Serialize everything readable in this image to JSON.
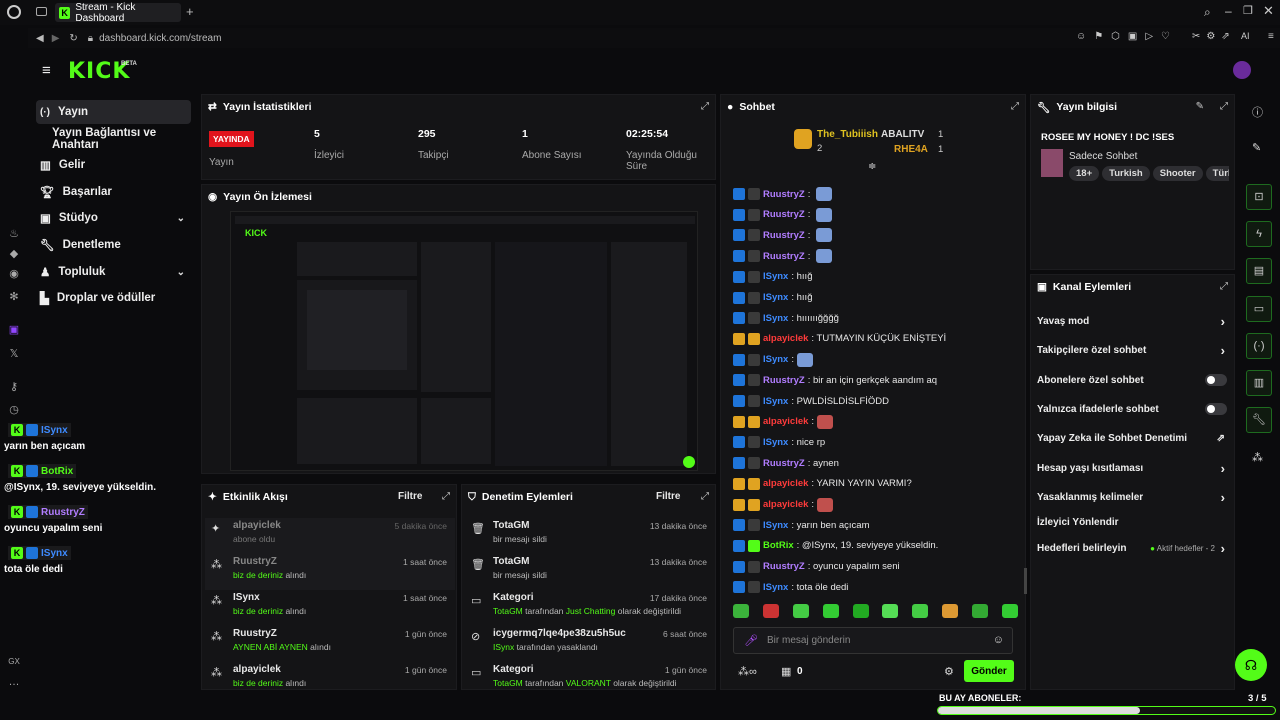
{
  "browser": {
    "tab_title": "Stream - Kick Dashboard",
    "new_tab": "+",
    "url": "dashboard.kick.com/stream",
    "gx_label": "GX",
    "ai_label": "AI"
  },
  "header": {
    "logo": "KICK",
    "beta": "BETA"
  },
  "nav": {
    "items": [
      {
        "label": "Yayın",
        "icon": "broadcast-icon"
      },
      {
        "label": "Yayın Bağlantısı ve Anahtarı",
        "icon": ""
      },
      {
        "label": "Gelir",
        "icon": "revenue-icon"
      },
      {
        "label": "Başarılar",
        "icon": "trophy-icon"
      },
      {
        "label": "Stüdyo",
        "icon": "studio-icon"
      },
      {
        "label": "Denetleme",
        "icon": "wrench-icon"
      },
      {
        "label": "Topluluk",
        "icon": "community-icon"
      },
      {
        "label": "Droplar ve ödüller",
        "icon": "drops-icon"
      }
    ]
  },
  "stats": {
    "title": "Yayın İstatistikleri",
    "live_badge": "YAYINDA",
    "live_label": "Yayın",
    "viewers_value": "5",
    "viewers_label": "İzleyici",
    "followers_value": "295",
    "followers_label": "Takipçi",
    "subs_value": "1",
    "subs_label": "Abone Sayısı",
    "uptime_value": "02:25:54",
    "uptime_label": "Yayında Olduğu Süre"
  },
  "preview": {
    "title": "Yayın Ön İzlemesi"
  },
  "events": {
    "title": "Etkinlik Akışı",
    "filter": "Filtre",
    "rows": [
      {
        "name": "alpayiclek",
        "sub": "abone oldu",
        "time": "5 dakika önce"
      },
      {
        "name": "RuustryZ",
        "sub_green": "biz de deriniz",
        "sub": " alındı",
        "time": "1 saat önce"
      },
      {
        "name": "ISynx",
        "sub_green": "biz de deriniz",
        "sub": " alındı",
        "time": "1 saat önce"
      },
      {
        "name": "RuustryZ",
        "sub_green": "AYNEN ABİ AYNEN",
        "sub": " alındı",
        "time": "1 gün önce"
      },
      {
        "name": "alpayiclek",
        "sub_green": "biz de deriniz",
        "sub": " alındı",
        "time": "1 gün önce"
      }
    ]
  },
  "moderation": {
    "title": "Denetim Eylemleri",
    "filter": "Filtre",
    "rows": [
      {
        "name": "TotaGM",
        "sub": "bir mesajı sildi",
        "time": "13 dakika önce"
      },
      {
        "name": "TotaGM",
        "sub": "bir mesajı sildi",
        "time": "13 dakika önce"
      },
      {
        "name": "Kategori",
        "sub_green": "TotaGM",
        "sub": " tarafından ",
        "sub_green2": "Just Chatting",
        "sub2": " olarak değiştirildi",
        "time": "17 dakika önce"
      },
      {
        "name": "icygermq7lqe4pe38zu5h5uc",
        "sub_green": "ISynx",
        "sub": " tarafından yasaklandı",
        "time": "6 saat önce"
      },
      {
        "name": "Kategori",
        "sub_green": "TotaGM",
        "sub": " tarafından ",
        "sub_green2": "VALORANT",
        "sub2": " olarak değiştirildi",
        "time": "1 gün önce"
      }
    ]
  },
  "chat": {
    "title": "Sohbet",
    "top1": "The_Tubiiish",
    "top1_count": "2",
    "top2": "ABALITV",
    "top2_count": "1",
    "top3": "RHE4A",
    "top3_count": "1",
    "messages": [
      {
        "user": "RuustryZ",
        "color": "purple",
        "text": "",
        "emote": true
      },
      {
        "user": "RuustryZ",
        "color": "purple",
        "text": "",
        "emote": true
      },
      {
        "user": "RuustryZ",
        "color": "purple",
        "text": "",
        "emote": true
      },
      {
        "user": "RuustryZ",
        "color": "purple",
        "text": "",
        "emote": true
      },
      {
        "user": "ISynx",
        "color": "blue",
        "text": ": hıığ"
      },
      {
        "user": "ISynx",
        "color": "blue",
        "text": ": hıığ"
      },
      {
        "user": "ISynx",
        "color": "blue",
        "text": ": hıııııığğğğ"
      },
      {
        "user": "alpayiclek",
        "color": "red",
        "text": ": TUTMAYIN KÜÇÜK ENİŞTEYİ"
      },
      {
        "user": "ISynx",
        "color": "blue",
        "text": ":",
        "emote": true
      },
      {
        "user": "RuustryZ",
        "color": "purple",
        "text": ": bir an için gerkçek aandım aq"
      },
      {
        "user": "ISynx",
        "color": "blue",
        "text": ": PWLDİSLDİSLFİÖDD"
      },
      {
        "user": "alpayiclek",
        "color": "red",
        "text": ":",
        "emote": true
      },
      {
        "user": "ISynx",
        "color": "blue",
        "text": ": nice rp"
      },
      {
        "user": "RuustryZ",
        "color": "purple",
        "text": ": aynen"
      },
      {
        "user": "alpayiclek",
        "color": "red",
        "text": ": YARIN YAYIN VARMI?"
      },
      {
        "user": "alpayiclek",
        "color": "red",
        "text": ":",
        "emote": true
      },
      {
        "user": "ISynx",
        "color": "blue",
        "text": ": yarın ben açıcam"
      },
      {
        "user": "BotRix",
        "color": "green",
        "text": ": @ISynx, 19. seviyeye yükseldin."
      },
      {
        "user": "RuustryZ",
        "color": "purple",
        "text": ": oyuncu yapalım seni"
      },
      {
        "user": "ISynx",
        "color": "blue",
        "text": ": tota öle dedi"
      }
    ],
    "input_placeholder": "Bir mesaj gönderin",
    "points": "0",
    "send": "Gönder"
  },
  "info": {
    "title": "Yayın bilgisi",
    "stream_title": "ROSEE MY HONEY ! DC !SES",
    "category": "Sadece Sohbet",
    "tags": [
      "18+",
      "Turkish",
      "Shooter",
      "Türk"
    ]
  },
  "actions": {
    "title": "Kanal Eylemleri",
    "rows": [
      {
        "label": "Yavaş mod",
        "type": "chevron"
      },
      {
        "label": "Takipçilere özel sohbet",
        "type": "chevron"
      },
      {
        "label": "Abonelere özel sohbet",
        "type": "toggle"
      },
      {
        "label": "Yalnızca ifadelerle sohbet",
        "type": "toggle"
      },
      {
        "label": "Yapay Zeka ile Sohbet Denetimi",
        "type": "external"
      },
      {
        "label": "Hesap yaşı kısıtlaması",
        "type": "chevron"
      },
      {
        "label": "Yasaklanmış kelimeler",
        "type": "chevron"
      },
      {
        "label": "İzleyici Yönlendir",
        "type": "none"
      },
      {
        "label": "Hedefleri belirleyin",
        "type": "goal",
        "extra": "Aktif hedefler - 2"
      }
    ]
  },
  "goal": {
    "label": "BU AY ABONELER:",
    "progress": "3 / 5",
    "fraction": 0.6
  },
  "overlay_chat": [
    {
      "user": "ISynx",
      "color": "blue",
      "text": "yarın ben açıcam"
    },
    {
      "user": "BotRix",
      "color": "green",
      "text": "@ISynx, 19. seviyeye yükseldin."
    },
    {
      "user": "RuustryZ",
      "color": "purple",
      "text": "oyuncu yapalım seni"
    },
    {
      "user": "ISynx",
      "color": "blue",
      "text": "tota öle dedi"
    }
  ],
  "colors": {
    "accent": "#53fc18",
    "live": "#e1141c",
    "background": "#0b0b0d",
    "panel": "#141416"
  }
}
